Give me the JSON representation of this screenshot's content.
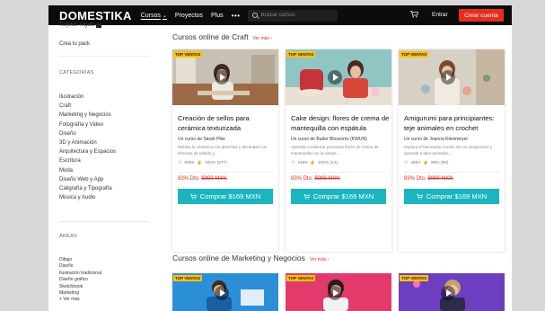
{
  "header": {
    "logo": "DOMESTIKA",
    "nav": [
      "Cursos",
      "Proyectos",
      "Plus"
    ],
    "more": "•••",
    "search_placeholder": "Buscar cursos",
    "enter": "Entrar",
    "signup": "Crear cuenta"
  },
  "sidebar": {
    "top_cut": "Tarjetas regalo",
    "pack": "Crea tu pack",
    "categories_title": "CATEGORÍAS",
    "categories": [
      "Ilustración",
      "Craft",
      "Marketing y Negocios",
      "Fotografía y Video",
      "Diseño",
      "3D y Animación",
      "Arquitectura y Espacios",
      "Escritura",
      "Moda",
      "Diseño Web y App",
      "Caligrafía y Tipografía",
      "Música y Audio"
    ],
    "areas_title": "ÁREAS",
    "areas": [
      "Dibujo",
      "Diseño",
      "Ilustración tradicional",
      "Diseño gráfico",
      "Sketchbook",
      "Marketing",
      "+ Ver más"
    ]
  },
  "craft_section": {
    "title": "Cursos online de Craft",
    "see_more": "Ver más ›",
    "courses": [
      {
        "badge": "TOP VENTAS",
        "title": "Creación de sellos para cerámica texturizada",
        "author": "Un curso de Sarah Pike",
        "desc": "Moldea la cerámica con planchas y decóralas con técnicas de tallado y...",
        "students": "8058",
        "rating": "100% (277)",
        "discount": "83% Dto.",
        "old_price": "$999 MXN",
        "buy": "Comprar $169 MXN"
      },
      {
        "badge": "TOP VENTAS",
        "title": "Cake design: flores de crema de mantequilla con espátula",
        "author": "Un curso de Butter Blossoms (KWUN)",
        "desc": "Aprende a elaborar preciosas flores de crema de mantequilla con la simple...",
        "students": "2469",
        "rating": "100% (41)",
        "discount": "83% Dto.",
        "old_price": "$999 MXN",
        "buy": "Comprar $169 MXN"
      },
      {
        "badge": "TOP VENTAS",
        "title": "Amigurumi para principiantes: teje animales en crochet",
        "author": "Un curso de Joanna Kleinmeyer",
        "desc": "Explora el fascinante mundo de los amigurumis y aprende a tejer animales...",
        "students": "4882",
        "rating": "98% (59)",
        "discount": "83% Dto.",
        "old_price": "$999 MXN",
        "buy": "Comprar $169 MXN"
      }
    ]
  },
  "marketing_section": {
    "title": "Cursos online de Marketing y Negocios",
    "see_more": "Ver más ›",
    "badges": [
      "TOP VENTAS",
      "TOP VENTAS",
      "TOP VENTAS"
    ]
  },
  "colors": {
    "accent": "#e62d1e",
    "buy": "#1ab5bf",
    "badge": "#ffc107",
    "header": "#0c0c0c"
  }
}
